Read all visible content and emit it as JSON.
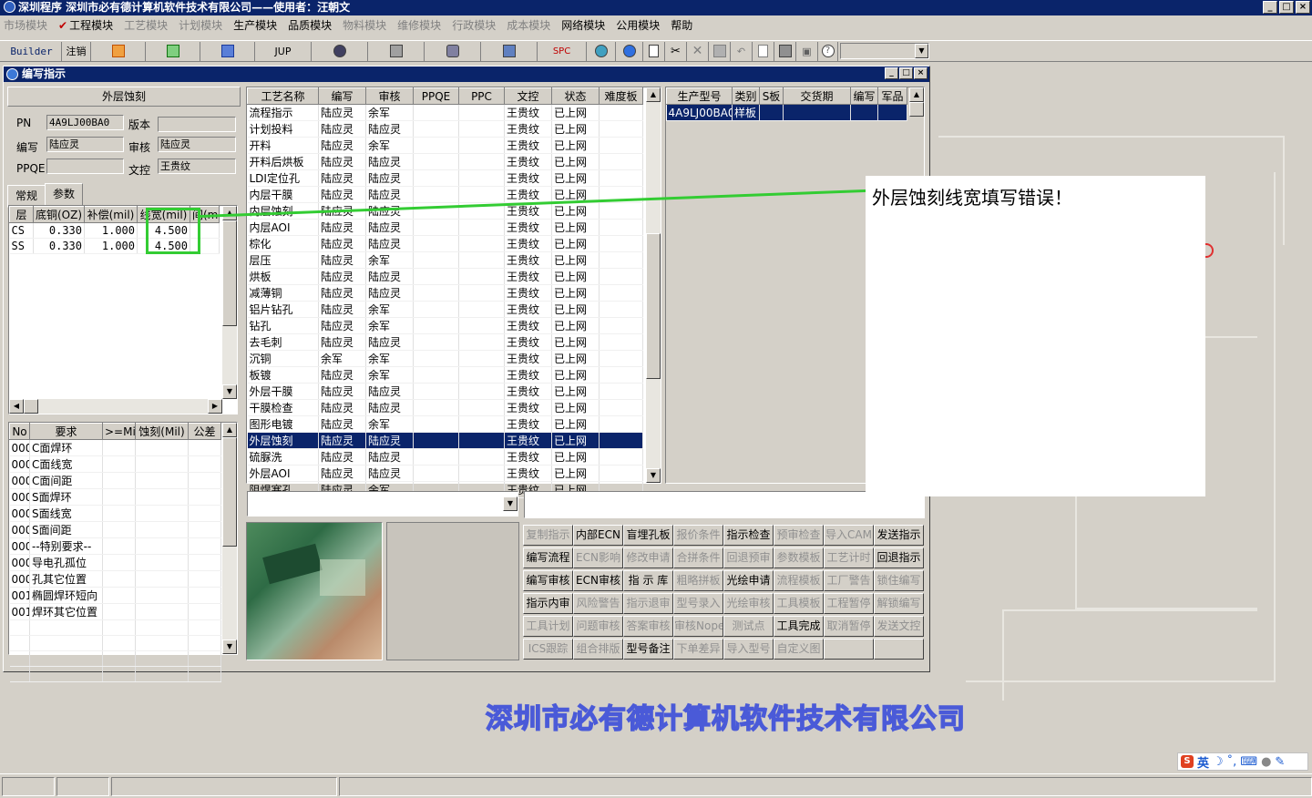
{
  "app": {
    "title": "深圳程序   深圳市必有德计算机软件技术有限公司——使用者：汪朝文",
    "win_min": "_",
    "win_max": "□",
    "win_close": "×"
  },
  "menu": [
    {
      "label": "市场模块",
      "enabled": false
    },
    {
      "label": "工程模块",
      "enabled": true,
      "checked": true
    },
    {
      "label": "工艺模块",
      "enabled": false
    },
    {
      "label": "计划模块",
      "enabled": false
    },
    {
      "label": "生产模块",
      "enabled": true
    },
    {
      "label": "品质模块",
      "enabled": true
    },
    {
      "label": "物料模块",
      "enabled": false
    },
    {
      "label": "维修模块",
      "enabled": false
    },
    {
      "label": "行政模块",
      "enabled": false
    },
    {
      "label": "成本模块",
      "enabled": false
    },
    {
      "label": "网络模块",
      "enabled": true
    },
    {
      "label": "公用模块",
      "enabled": true
    },
    {
      "label": "帮助",
      "enabled": true
    }
  ],
  "toolbar": {
    "builder": "Builder",
    "logout": "注销",
    "jup": "JUP",
    "spc": "SPC",
    "icons": [
      "ppt-icon",
      "excel-icon",
      "word-icon",
      "eye-icon",
      "server-icon",
      "network-icon",
      "computer-icon",
      "spc-icon",
      "refresh-icon",
      "ie-icon",
      "new-file-icon",
      "cut-icon",
      "delete-icon",
      "save-icon",
      "undo-icon",
      "preview-icon",
      "print-icon",
      "find-icon",
      "help-icon"
    ]
  },
  "child": {
    "title": "编写指示",
    "section": "外层蚀刻",
    "pn_label": "PN",
    "pn": "4A9LJ00BA0",
    "version_label": "版本",
    "version": "",
    "writer_label": "编写",
    "writer": "陆应灵",
    "reviewer_label": "审核",
    "reviewer": "陆应灵",
    "ppqe_label": "PPQE",
    "ppqe": "",
    "doc_label": "文控",
    "doc": "王贵纹",
    "tab_normal": "常规",
    "tab_params": "参数"
  },
  "params_table": {
    "headers": [
      "层",
      "底铜(OZ)",
      "补偿(mil)",
      "线宽(mil)",
      "间(mi"
    ],
    "rows": [
      [
        "CS",
        "0.330",
        "1.000",
        "4.500",
        ""
      ],
      [
        "SS",
        "0.330",
        "1.000",
        "4.500",
        ""
      ]
    ]
  },
  "req_table": {
    "headers": [
      "No",
      "要求",
      ">=Mil",
      "蚀刻(Mil)",
      "公差"
    ],
    "rows": [
      [
        "000",
        "C面焊环"
      ],
      [
        "000",
        "C面线宽"
      ],
      [
        "000",
        "C面间距"
      ],
      [
        "000",
        "S面焊环"
      ],
      [
        "000",
        "S面线宽"
      ],
      [
        "000",
        "S面间距"
      ],
      [
        "000",
        "--特别要求--"
      ],
      [
        "000",
        "导电孔孤位"
      ],
      [
        "000",
        "孔其它位置"
      ],
      [
        "001",
        "椭圆焊环短向"
      ],
      [
        "001",
        "焊环其它位置"
      ]
    ]
  },
  "process_table": {
    "headers": [
      "工艺名称",
      "编写",
      "审核",
      "PPQE",
      "PPC",
      "文控",
      "状态",
      "难度板"
    ],
    "rows": [
      [
        "流程指示",
        "陆应灵",
        "余军",
        "",
        "",
        "王贵纹",
        "已上网"
      ],
      [
        "计划投料",
        "陆应灵",
        "陆应灵",
        "",
        "",
        "王贵纹",
        "已上网"
      ],
      [
        "开料",
        "陆应灵",
        "余军",
        "",
        "",
        "王贵纹",
        "已上网"
      ],
      [
        "开料后烘板",
        "陆应灵",
        "陆应灵",
        "",
        "",
        "王贵纹",
        "已上网"
      ],
      [
        "LDI定位孔",
        "陆应灵",
        "陆应灵",
        "",
        "",
        "王贵纹",
        "已上网"
      ],
      [
        "内层干膜",
        "陆应灵",
        "陆应灵",
        "",
        "",
        "王贵纹",
        "已上网"
      ],
      [
        "内层蚀刻",
        "陆应灵",
        "陆应灵",
        "",
        "",
        "王贵纹",
        "已上网"
      ],
      [
        "内层AOI",
        "陆应灵",
        "陆应灵",
        "",
        "",
        "王贵纹",
        "已上网"
      ],
      [
        "棕化",
        "陆应灵",
        "陆应灵",
        "",
        "",
        "王贵纹",
        "已上网"
      ],
      [
        "层压",
        "陆应灵",
        "余军",
        "",
        "",
        "王贵纹",
        "已上网"
      ],
      [
        "烘板",
        "陆应灵",
        "陆应灵",
        "",
        "",
        "王贵纹",
        "已上网"
      ],
      [
        "减薄铜",
        "陆应灵",
        "陆应灵",
        "",
        "",
        "王贵纹",
        "已上网"
      ],
      [
        "铝片钻孔",
        "陆应灵",
        "余军",
        "",
        "",
        "王贵纹",
        "已上网"
      ],
      [
        "钻孔",
        "陆应灵",
        "余军",
        "",
        "",
        "王贵纹",
        "已上网"
      ],
      [
        "去毛刺",
        "陆应灵",
        "陆应灵",
        "",
        "",
        "王贵纹",
        "已上网"
      ],
      [
        "沉铜",
        "余军",
        "余军",
        "",
        "",
        "王贵纹",
        "已上网"
      ],
      [
        "板镀",
        "陆应灵",
        "余军",
        "",
        "",
        "王贵纹",
        "已上网"
      ],
      [
        "外层干膜",
        "陆应灵",
        "陆应灵",
        "",
        "",
        "王贵纹",
        "已上网"
      ],
      [
        "干膜检查",
        "陆应灵",
        "陆应灵",
        "",
        "",
        "王贵纹",
        "已上网"
      ],
      [
        "图形电镀",
        "陆应灵",
        "余军",
        "",
        "",
        "王贵纹",
        "已上网"
      ],
      [
        "外层蚀刻",
        "陆应灵",
        "陆应灵",
        "",
        "",
        "王贵纹",
        "已上网"
      ],
      [
        "硫脲洗",
        "陆应灵",
        "陆应灵",
        "",
        "",
        "王贵纹",
        "已上网"
      ],
      [
        "外层AOI",
        "陆应灵",
        "陆应灵",
        "",
        "",
        "王贵纹",
        "已上网"
      ],
      [
        "阻焊塞孔",
        "陆应灵",
        "余军",
        "",
        "",
        "王贵纹",
        "已上网"
      ]
    ],
    "selected_index": 20
  },
  "product_table": {
    "headers": [
      "生产型号",
      "类别",
      "S板",
      "交货期",
      "编写",
      "军品"
    ],
    "rows": [
      [
        "4A9LJ00BA0",
        "样板",
        "",
        "",
        "",
        ""
      ]
    ]
  },
  "func_buttons": [
    [
      {
        "l": "复制指示",
        "e": false
      },
      {
        "l": "内部ECN",
        "e": true
      },
      {
        "l": "盲埋孔板",
        "e": true
      },
      {
        "l": "报价条件",
        "e": false
      },
      {
        "l": "指示检查",
        "e": true
      },
      {
        "l": "预审检查",
        "e": false
      },
      {
        "l": "导入CAM",
        "e": false
      },
      {
        "l": "发送指示",
        "e": true
      }
    ],
    [
      {
        "l": "编写流程",
        "e": true
      },
      {
        "l": "ECN影响",
        "e": false
      },
      {
        "l": "修改申请",
        "e": false
      },
      {
        "l": "合拼条件",
        "e": false
      },
      {
        "l": "回退预审",
        "e": false
      },
      {
        "l": "参数模板",
        "e": false
      },
      {
        "l": "工艺计时",
        "e": false
      },
      {
        "l": "回退指示",
        "e": true
      }
    ],
    [
      {
        "l": "编写审核",
        "e": true
      },
      {
        "l": "ECN审核",
        "e": true
      },
      {
        "l": "指 示 库",
        "e": true
      },
      {
        "l": "粗略拼板",
        "e": false
      },
      {
        "l": "光绘申请",
        "e": true
      },
      {
        "l": "流程模板",
        "e": false
      },
      {
        "l": "工厂警告",
        "e": false
      },
      {
        "l": "锁住编写",
        "e": false
      }
    ],
    [
      {
        "l": "指示内审",
        "e": true
      },
      {
        "l": "风险警告",
        "e": false
      },
      {
        "l": "指示退审",
        "e": false
      },
      {
        "l": "型号录入",
        "e": false
      },
      {
        "l": "光绘审核",
        "e": false
      },
      {
        "l": "工具模板",
        "e": false
      },
      {
        "l": "工程暂停",
        "e": false
      },
      {
        "l": "解锁编写",
        "e": false
      }
    ],
    [
      {
        "l": "工具计划",
        "e": false
      },
      {
        "l": "问题审核",
        "e": false
      },
      {
        "l": "答案审核",
        "e": false
      },
      {
        "l": "审核Nope",
        "e": false
      },
      {
        "l": "测试点",
        "e": false
      },
      {
        "l": "工具完成",
        "e": true
      },
      {
        "l": "取消暂停",
        "e": false
      },
      {
        "l": "发送文控",
        "e": false
      }
    ],
    [
      {
        "l": "ICS跟踪",
        "e": false
      },
      {
        "l": "组合排版",
        "e": false
      },
      {
        "l": "型号备注",
        "e": true
      },
      {
        "l": "下单差异",
        "e": false
      },
      {
        "l": "导入型号",
        "e": false
      },
      {
        "l": "自定义图",
        "e": false
      },
      {
        "l": "",
        "e": false
      },
      {
        "l": "",
        "e": false
      }
    ]
  ],
  "callout": {
    "text": "外层蚀刻线宽填写错误！"
  },
  "company": "深圳市必有德计算机软件技术有限公司",
  "ime": {
    "lang": "英"
  }
}
